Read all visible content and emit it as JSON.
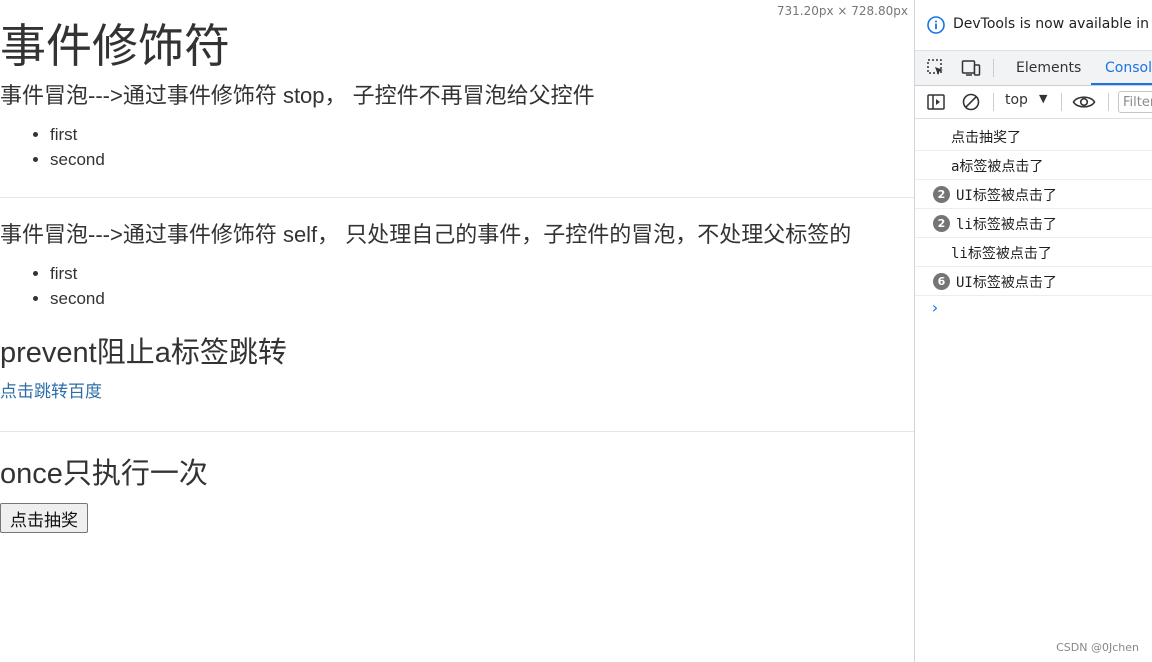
{
  "page": {
    "size_readout": "731.20px × 728.80px",
    "title": "事件修饰符",
    "section_stop": {
      "heading": "事件冒泡--->通过事件修饰符 stop， 子控件不再冒泡给父控件",
      "items": [
        "first",
        "second"
      ]
    },
    "section_self": {
      "heading": "事件冒泡--->通过事件修饰符 self， 只处理自己的事件，子控件的冒泡，不处理父标签的",
      "items": [
        "first",
        "second"
      ]
    },
    "section_prevent": {
      "heading": "prevent阻止a标签跳转",
      "link_label": "点击跳转百度"
    },
    "section_once": {
      "heading": "once只执行一次",
      "button_label": "点击抽奖"
    }
  },
  "devtools": {
    "banner_text": "DevTools is now available in Chinese",
    "tabs": [
      {
        "label": "Elements",
        "active": false
      },
      {
        "label": "Console",
        "active": true
      }
    ],
    "context_select": "top",
    "filter_placeholder": "Filter",
    "messages": [
      {
        "count": "",
        "text": "点击抽奖了"
      },
      {
        "count": "",
        "text": "a标签被点击了"
      },
      {
        "count": "2",
        "text": "UI标签被点击了"
      },
      {
        "count": "2",
        "text": "li标签被点击了"
      },
      {
        "count": "",
        "text": "li标签被点击了"
      },
      {
        "count": "6",
        "text": "UI标签被点击了"
      }
    ],
    "prompt_symbol": "›"
  },
  "watermark": "CSDN @0Jchen",
  "colors": {
    "link": "#2d6ea8",
    "active_tab": "#1a73e8",
    "badge": "#757575"
  }
}
